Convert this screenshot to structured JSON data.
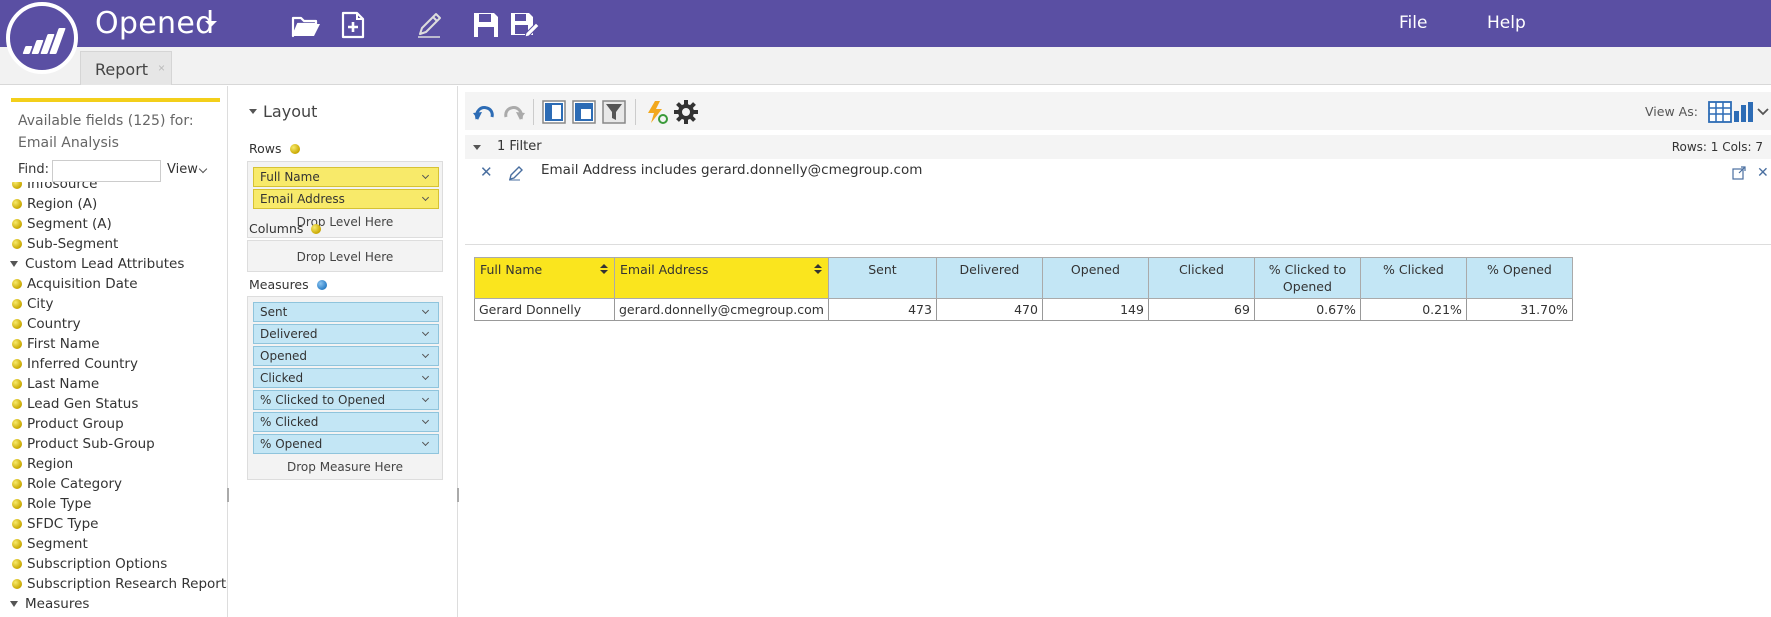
{
  "app": {
    "title": "Opened"
  },
  "menu": {
    "file": "File",
    "help": "Help"
  },
  "tabs": [
    {
      "label": "Report",
      "close": "×"
    }
  ],
  "fields_panel": {
    "available_line1": "Available fields (125) for:",
    "available_line2": "Email Analysis",
    "find_label": "Find:",
    "find_value": "",
    "view_label": "View",
    "items": [
      {
        "label": "Infosource",
        "type": "field"
      },
      {
        "label": "Region (A)",
        "type": "field"
      },
      {
        "label": "Segment (A)",
        "type": "field"
      },
      {
        "label": "Sub-Segment",
        "type": "field"
      },
      {
        "label": "Custom Lead Attributes",
        "type": "group"
      },
      {
        "label": "Acquisition Date",
        "type": "field"
      },
      {
        "label": "City",
        "type": "field"
      },
      {
        "label": "Country",
        "type": "field"
      },
      {
        "label": "First Name",
        "type": "field"
      },
      {
        "label": "Inferred Country",
        "type": "field"
      },
      {
        "label": "Last Name",
        "type": "field"
      },
      {
        "label": "Lead Gen Status",
        "type": "field"
      },
      {
        "label": "Product Group",
        "type": "field"
      },
      {
        "label": "Product Sub-Group",
        "type": "field"
      },
      {
        "label": "Region",
        "type": "field"
      },
      {
        "label": "Role Category",
        "type": "field"
      },
      {
        "label": "Role Type",
        "type": "field"
      },
      {
        "label": "SFDC Type",
        "type": "field"
      },
      {
        "label": "Segment",
        "type": "field"
      },
      {
        "label": "Subscription Options",
        "type": "field"
      },
      {
        "label": "Subscription Research Reports",
        "type": "field"
      },
      {
        "label": "Measures",
        "type": "group"
      }
    ]
  },
  "layout_panel": {
    "title": "Layout",
    "rows_label": "Rows",
    "rows": [
      "Full Name",
      "Email Address"
    ],
    "rows_drop": "Drop Level Here",
    "columns_label": "Columns",
    "columns_drop": "Drop Level Here",
    "measures_label": "Measures",
    "measures": [
      "Sent",
      "Delivered",
      "Opened",
      "Clicked",
      "% Clicked to Opened",
      "% Clicked",
      "% Opened"
    ],
    "measures_drop": "Drop Measure Here"
  },
  "toolbar": {
    "view_as": "View As:"
  },
  "filters": {
    "count_label": "1 Filter",
    "rows_cols": "Rows: 1  Cols: 7",
    "items": [
      {
        "text": "Email Address includes gerard.donnelly@cmegroup.com"
      }
    ]
  },
  "table": {
    "row_headers": [
      "Full Name",
      "Email Address"
    ],
    "measure_headers": [
      "Sent",
      "Delivered",
      "Opened",
      "Clicked",
      "% Clicked to Opened",
      "% Clicked",
      "% Opened"
    ],
    "rows": [
      {
        "cells": [
          "Gerard Donnelly",
          "gerard.donnelly@cmegroup.com"
        ],
        "values": [
          "473",
          "470",
          "149",
          "69",
          "0.67%",
          "0.21%",
          "31.70%"
        ]
      }
    ]
  },
  "colors": {
    "brand": "#5a4fa3",
    "row_header": "#fae51e",
    "measure_header": "#c3e6f5",
    "accent_yellow": "#f3cf1a"
  }
}
